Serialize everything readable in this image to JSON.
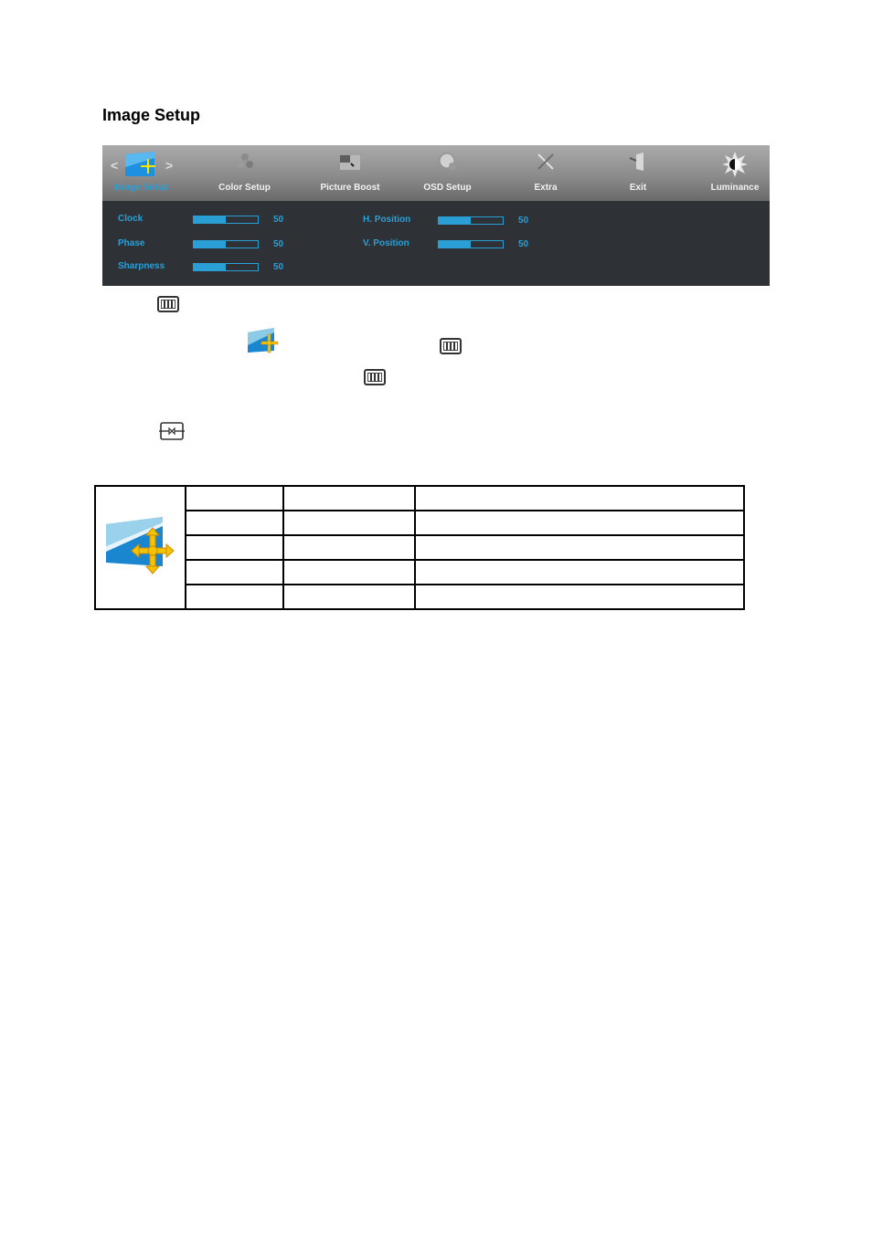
{
  "section": {
    "title": "Image Setup"
  },
  "osd": {
    "nav_left": "<",
    "nav_right": ">",
    "tabs": [
      {
        "label": "Image Setup",
        "icon": "image-setup-icon",
        "active": true
      },
      {
        "label": "Color Setup",
        "icon": "color-setup-icon",
        "active": false
      },
      {
        "label": "Picture Boost",
        "icon": "picture-boost-icon",
        "active": false
      },
      {
        "label": "OSD Setup",
        "icon": "osd-setup-icon",
        "active": false
      },
      {
        "label": "Extra",
        "icon": "extra-icon",
        "active": false
      },
      {
        "label": "Exit",
        "icon": "exit-icon",
        "active": false
      },
      {
        "label": "Luminance",
        "icon": "luminance-icon",
        "active": false
      }
    ],
    "settings": [
      {
        "label": "Clock",
        "value": "50",
        "percent": 50
      },
      {
        "label": "Phase",
        "value": "50",
        "percent": 50
      },
      {
        "label": "Sharpness",
        "value": "50",
        "percent": 50
      },
      {
        "label": "H. Position",
        "value": "50",
        "percent": 50
      },
      {
        "label": "V. Position",
        "value": "50",
        "percent": 50
      }
    ],
    "colors": {
      "accent": "#2a9fd6",
      "panel": "#2e3236",
      "header_top": "#aaaaaa",
      "header_bottom": "#6a6a6a"
    }
  },
  "instructions": {
    "icons": [
      "menu-key-icon",
      "image-setup-icon",
      "menu-key-icon",
      "menu-key-icon",
      "source-key-icon"
    ]
  },
  "table": {
    "icon": "image-setup-icon",
    "rows": [
      [
        "",
        "",
        ""
      ],
      [
        "",
        "",
        ""
      ],
      [
        "",
        "",
        ""
      ],
      [
        "",
        "",
        ""
      ],
      [
        "",
        "",
        ""
      ]
    ]
  }
}
